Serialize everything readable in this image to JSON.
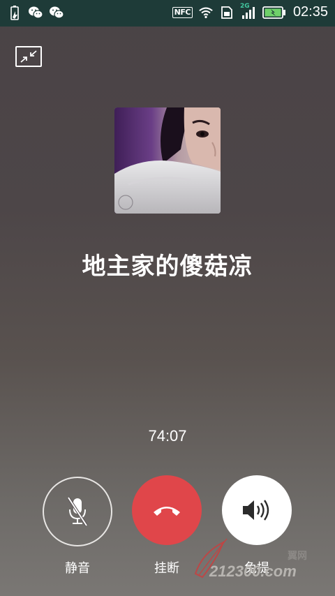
{
  "status_bar": {
    "time": "02:35",
    "nfc_label": "NFC",
    "network_type": "2G",
    "left_icons": [
      "battery-saver-icon",
      "wechat-icon",
      "wechat-icon"
    ],
    "right_icons": [
      "nfc-icon",
      "wifi-icon",
      "sim-icon",
      "cellular-signal-icon",
      "battery-charging-icon"
    ]
  },
  "call": {
    "contact_name": "地主家的傻菇凉",
    "duration": "74:07"
  },
  "controls": {
    "mute_label": "静音",
    "hangup_label": "挂断",
    "speaker_label": "免提"
  },
  "watermark": {
    "text": "212300.com",
    "cn": "翼网"
  },
  "colors": {
    "status_bar_bg": "#1e3b38",
    "hangup": "#e0464a",
    "accent_2g": "#42c8a0"
  }
}
